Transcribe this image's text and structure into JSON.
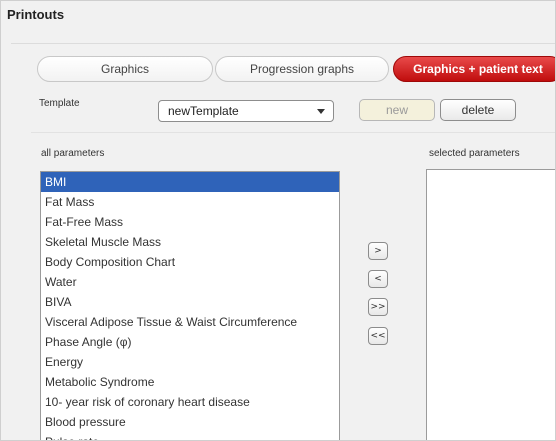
{
  "window": {
    "title": "Printouts"
  },
  "tabs": [
    {
      "label": "Graphics",
      "active": false
    },
    {
      "label": "Progression graphs",
      "active": false
    },
    {
      "label": "Graphics + patient text",
      "active": true
    }
  ],
  "template": {
    "label": "Template",
    "selected": "newTemplate",
    "new_label": "new",
    "delete_label": "delete"
  },
  "all_parameters": {
    "label": "all parameters",
    "items": [
      {
        "label": "BMI",
        "selected": true
      },
      {
        "label": "Fat Mass"
      },
      {
        "label": "Fat-Free Mass"
      },
      {
        "label": "Skeletal Muscle Mass"
      },
      {
        "label": "Body Composition Chart"
      },
      {
        "label": "Water"
      },
      {
        "label": "BIVA"
      },
      {
        "label": "Visceral Adipose Tissue & Waist Circumference"
      },
      {
        "label": "Phase Angle (φ)"
      },
      {
        "label": "Energy"
      },
      {
        "label": "Metabolic Syndrome"
      },
      {
        "label": "10- year risk of coronary heart disease"
      },
      {
        "label": "Blood pressure"
      },
      {
        "label": "Pulse rate"
      }
    ]
  },
  "transfer_buttons": {
    "add": ">",
    "remove": "<",
    "add_all": ">>",
    "remove_all": "<<"
  },
  "selected_parameters": {
    "label": "selected parameters",
    "items": []
  },
  "colors": {
    "active_tab": "#d21a1a",
    "selection": "#2f63b9",
    "background": "#f1f1f1"
  }
}
